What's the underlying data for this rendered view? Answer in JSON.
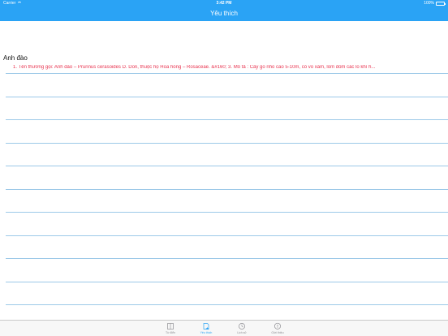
{
  "status_bar": {
    "carrier": "Carrier",
    "time": "3:42 PM",
    "battery": "100%"
  },
  "nav": {
    "title": "Yêu thích"
  },
  "entries": [
    {
      "title": "Anh đào",
      "description": "1. Tên thường gọi:     Anh đào – Prunnus cerasoides D. Don, thuộc họ Hoa hồng – Rosaceae.  &#160;      3. Mô tả   :  Cây gỗ nhỏ cao 5-10m, có vỏ xám, lốm đốm các lỗ khí h..."
    }
  ],
  "tabs": [
    {
      "label": "Từ điển",
      "icon": "book-icon",
      "active": false
    },
    {
      "label": "Yêu thích",
      "icon": "favorite-note-icon",
      "active": true
    },
    {
      "label": "Lịch sử",
      "icon": "clock-icon",
      "active": false
    },
    {
      "label": "Giới thiệu",
      "icon": "info-bubble-icon",
      "active": false
    }
  ],
  "colors": {
    "accent": "#2aa3f5",
    "description_text": "#e8334f",
    "separator": "#9cc9e8",
    "tab_inactive": "#8e8e93"
  }
}
